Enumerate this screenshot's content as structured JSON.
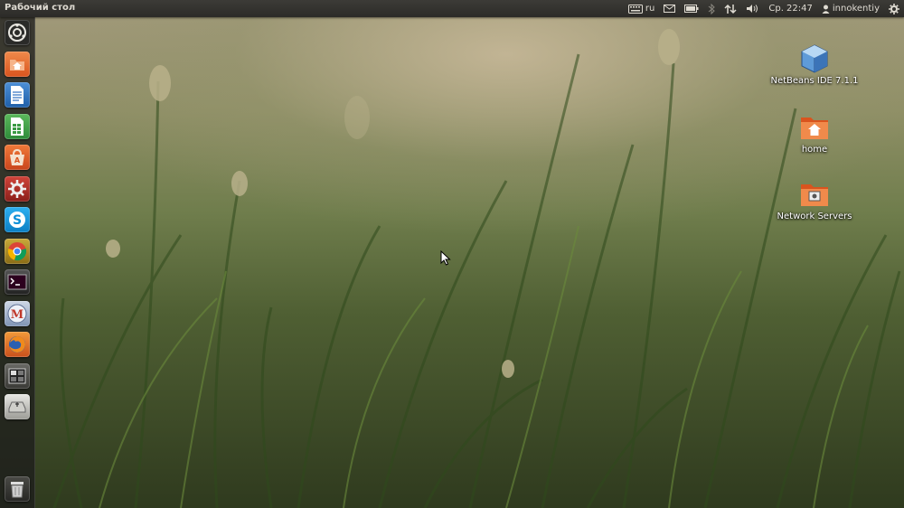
{
  "top_panel": {
    "app_title": "Рабочий стол",
    "keyboard_layout": "ru",
    "clock": "Ср. 22:47",
    "user": "innokentiy"
  },
  "launcher": {
    "items": [
      {
        "icon": "dash-home-icon"
      },
      {
        "icon": "home-folder-icon"
      },
      {
        "icon": "libreoffice-writer-icon"
      },
      {
        "icon": "libreoffice-calc-icon"
      },
      {
        "icon": "ubuntu-software-center-icon"
      },
      {
        "icon": "system-settings-icon"
      },
      {
        "icon": "skype-icon"
      },
      {
        "icon": "chrome-icon"
      },
      {
        "icon": "terminal-icon"
      },
      {
        "icon": "gmail-notifier-icon"
      },
      {
        "icon": "firefox-icon"
      },
      {
        "icon": "workspace-switcher-icon"
      },
      {
        "icon": "removable-drive-icon"
      },
      {
        "icon": "trash-icon"
      }
    ]
  },
  "desktop_icons": [
    {
      "label": "NetBeans IDE 7.1.1",
      "icon": "netbeans-icon"
    },
    {
      "label": "home",
      "icon": "home-folder-icon"
    },
    {
      "label": "Network Servers",
      "icon": "network-folder-icon"
    }
  ],
  "colors": {
    "panel": "#3c3b37",
    "launcher": "#1e1e1c",
    "orange": "#e06a2a",
    "text": "#dfdbd2"
  }
}
